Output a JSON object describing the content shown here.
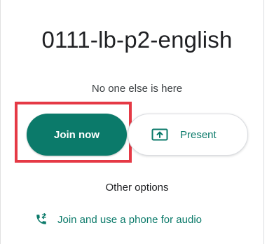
{
  "meeting": {
    "title": "0111-lb-p2-english",
    "status": "No one else is here"
  },
  "actions": {
    "join_label": "Join now",
    "present_label": "Present",
    "present_icon": "present-screen-icon"
  },
  "other_options": {
    "heading": "Other options",
    "phone_label": "Join and use a phone for audio",
    "phone_icon": "phone-forward-icon"
  },
  "colors": {
    "accent": "#0b7a6a",
    "highlight": "#e53945",
    "text": "#202124"
  }
}
